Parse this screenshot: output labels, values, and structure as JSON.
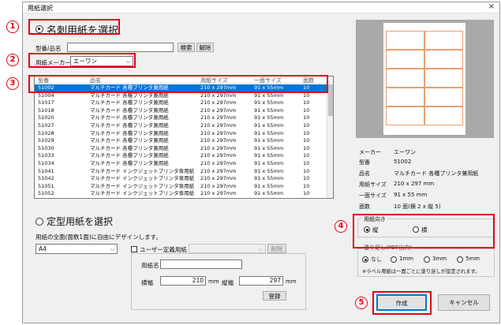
{
  "window": {
    "title": "用紙選択",
    "close": "×"
  },
  "section1": {
    "radio_label": "名刺用紙を選択"
  },
  "search": {
    "label": "型番/品名",
    "value": "",
    "search_btn": "検索",
    "clear_btn": "解除"
  },
  "maker": {
    "label": "用紙メーカー",
    "value": "エーワン"
  },
  "table": {
    "headers": [
      "型番",
      "品名",
      "用紙サイズ",
      "一面サイズ",
      "面数"
    ],
    "rows": [
      [
        "51002",
        "マルチカード 各種プリンタ兼用紙",
        "210 x 297mm",
        "91 x 55mm",
        "10"
      ],
      [
        "51004",
        "マルチカード 各種プリンタ兼用紙",
        "210 x 297mm",
        "91 x 55mm",
        "10"
      ],
      [
        "51017",
        "マルチカード 各種プリンタ兼用紙",
        "210 x 297mm",
        "91 x 55mm",
        "10"
      ],
      [
        "51018",
        "マルチカード 各種プリンタ兼用紙",
        "210 x 297mm",
        "91 x 55mm",
        "10"
      ],
      [
        "51020",
        "マルチカード 各種プリンタ兼用紙",
        "210 x 297mm",
        "91 x 55mm",
        "10"
      ],
      [
        "51027",
        "マルチカード 各種プリンタ兼用紙",
        "210 x 297mm",
        "91 x 55mm",
        "10"
      ],
      [
        "51028",
        "マルチカード 各種プリンタ兼用紙",
        "210 x 297mm",
        "91 x 55mm",
        "10"
      ],
      [
        "51029",
        "マルチカード 各種プリンタ兼用紙",
        "210 x 297mm",
        "91 x 55mm",
        "10"
      ],
      [
        "51030",
        "マルチカード 各種プリンタ兼用紙",
        "210 x 297mm",
        "91 x 55mm",
        "10"
      ],
      [
        "51033",
        "マルチカード 各種プリンタ兼用紙",
        "210 x 297mm",
        "91 x 55mm",
        "10"
      ],
      [
        "51034",
        "マルチカード 各種プリンタ兼用紙",
        "210 x 297mm",
        "91 x 55mm",
        "10"
      ],
      [
        "51041",
        "マルチカード インクジェットプリンタ専用紙",
        "210 x 297mm",
        "91 x 55mm",
        "10"
      ],
      [
        "51042",
        "マルチカード インクジェットプリンタ専用紙",
        "210 x 297mm",
        "91 x 55mm",
        "10"
      ],
      [
        "51051",
        "マルチカード インクジェットプリンタ専用紙",
        "210 x 297mm",
        "91 x 55mm",
        "10"
      ],
      [
        "51052",
        "マルチカード インクジェットプリンタ専用紙",
        "210 x 297mm",
        "91 x 55mm",
        "10"
      ]
    ]
  },
  "section2": {
    "radio_label": "定型用紙を選択",
    "desc": "用紙の全面(面数1面)に自由にデザインします。",
    "size_value": "A4",
    "user_def_label": "ユーザー定義用紙",
    "delete_btn": "削除",
    "name_label": "用紙名",
    "width_label": "横幅",
    "width_value": "210",
    "height_label": "縦幅",
    "height_value": "297",
    "unit": "mm",
    "register_btn": "登録"
  },
  "info": {
    "maker_label": "メーカー",
    "maker_value": "エーワン",
    "model_label": "型番",
    "model_value": "51002",
    "name_label": "品名",
    "name_value": "マルチカード 各種プリンタ兼用紙",
    "size_label": "用紙サイズ",
    "size_value": "210 x 297 mm",
    "face_label": "一面サイズ",
    "face_value": "91 x 55 mm",
    "count_label": "面数",
    "count_value": "10 面(横 2 x 縦 5)"
  },
  "orientation": {
    "label": "用紙向き",
    "portrait": "縦",
    "landscape": "横"
  },
  "bleed": {
    "label": "塗り足し(PDF出力)",
    "none": "なし",
    "opt1": "1mm",
    "opt2": "3mm",
    "opt3": "5mm",
    "note": "※ラベル用紙は一面ごとに塗り足しが設定されます。"
  },
  "actions": {
    "create": "作成",
    "cancel": "キャンセル"
  },
  "badges": {
    "b1": "1",
    "b2": "2",
    "b3": "3",
    "b4": "4",
    "b5": "5"
  },
  "colors": {
    "accent": "#e60012",
    "selection": "#0078d7"
  }
}
